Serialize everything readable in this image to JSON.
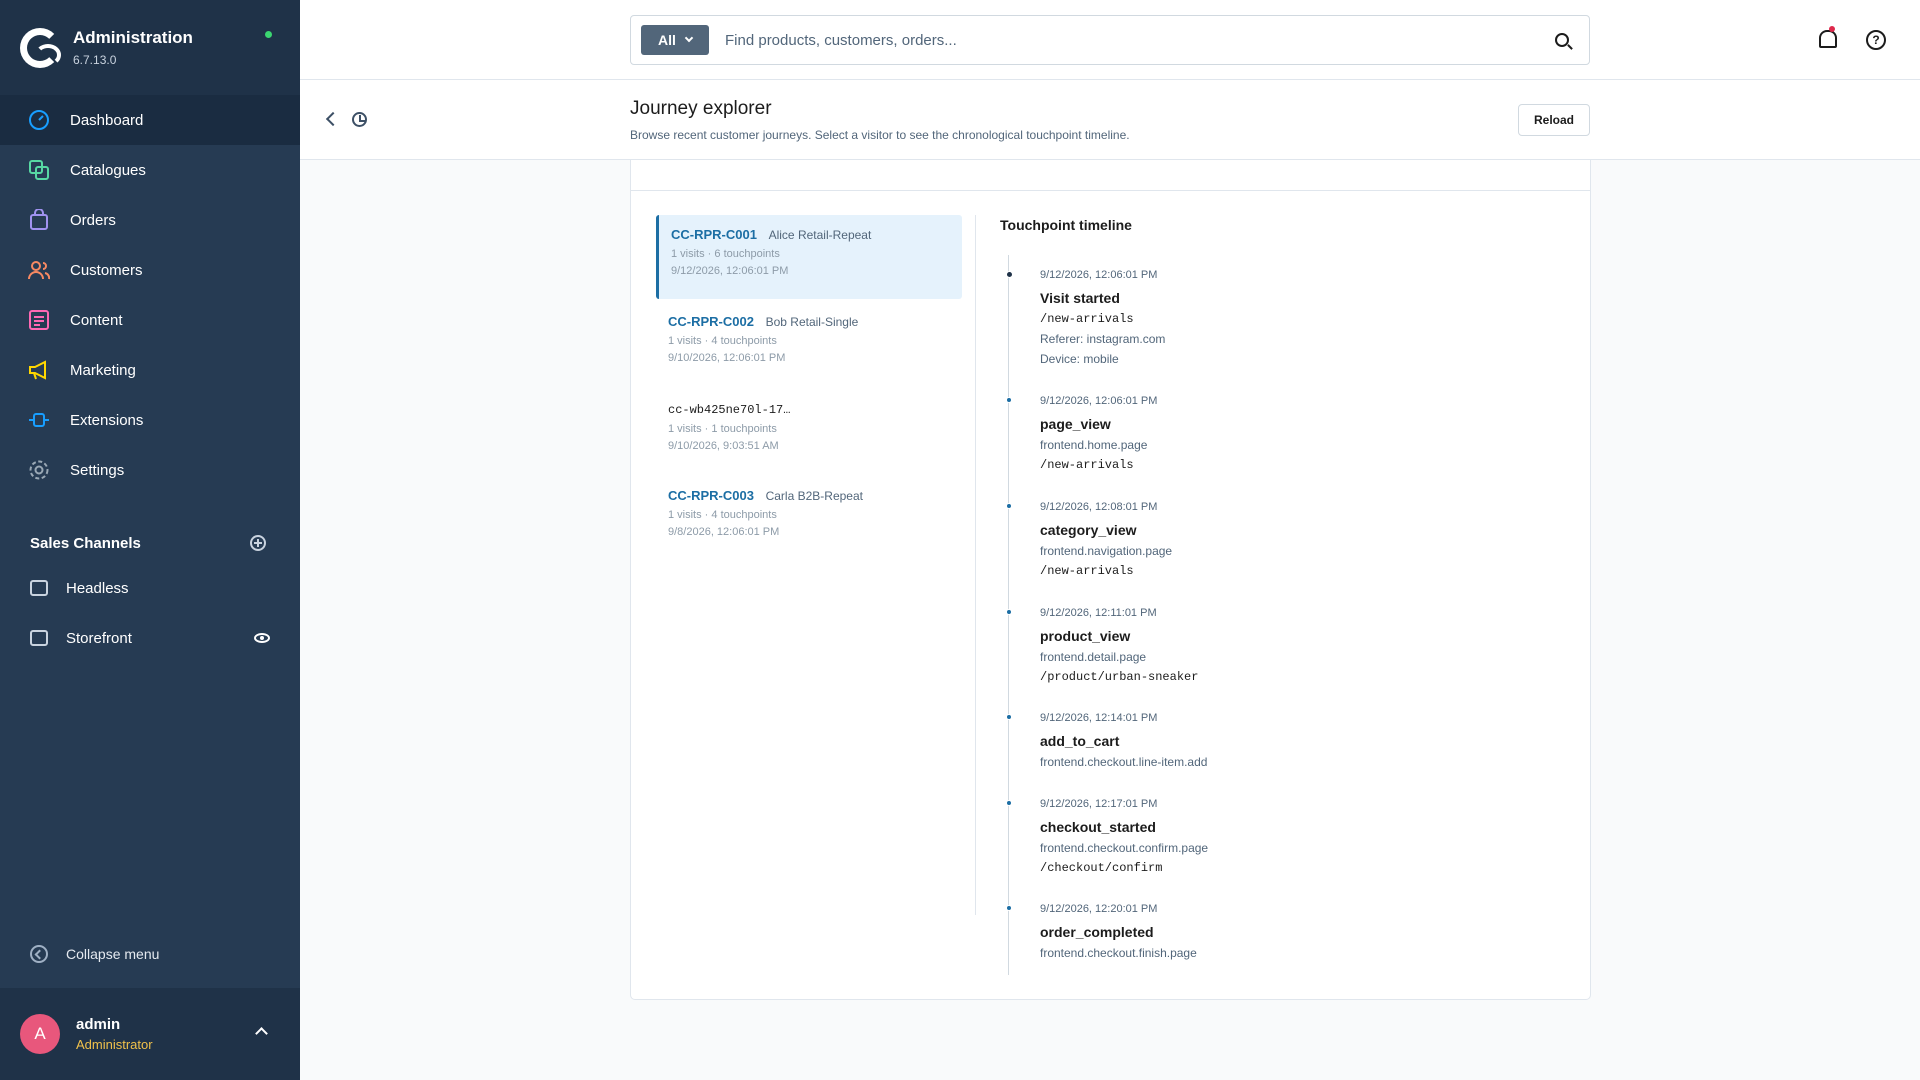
{
  "app": {
    "title": "Administration",
    "version": "6.7.13.0",
    "status_color": "#3bd671"
  },
  "nav": [
    {
      "label": "Dashboard",
      "icon": "dashboard-icon",
      "color": "#189eff",
      "active": true
    },
    {
      "label": "Catalogues",
      "icon": "catalogue-icon",
      "color": "#57d9a3"
    },
    {
      "label": "Orders",
      "icon": "orders-icon",
      "color": "#a092f0"
    },
    {
      "label": "Customers",
      "icon": "customers-icon",
      "color": "#f88962"
    },
    {
      "label": "Content",
      "icon": "content-icon",
      "color": "#ff68b4"
    },
    {
      "label": "Marketing",
      "icon": "marketing-icon",
      "color": "#ffd700"
    },
    {
      "label": "Extensions",
      "icon": "extensions-icon",
      "color": "#189eff"
    },
    {
      "label": "Settings",
      "icon": "settings-icon",
      "color": "#9aa8b5"
    }
  ],
  "sales_channels": {
    "title": "Sales Channels",
    "items": [
      {
        "label": "Headless",
        "icon": "basket-icon"
      },
      {
        "label": "Storefront",
        "icon": "storefront-icon"
      }
    ]
  },
  "collapse_label": "Collapse menu",
  "user": {
    "initial": "A",
    "name": "admin",
    "role": "Administrator"
  },
  "search": {
    "scope": "All",
    "placeholder": "Find products, customers, orders..."
  },
  "help_glyph": "?",
  "page": {
    "title": "Journey explorer",
    "description": "Browse recent customer journeys. Select a visitor to see the chronological touchpoint timeline.",
    "reload_label": "Reload"
  },
  "visitors": [
    {
      "id": "CC-RPR-C001",
      "name": "Alice Retail-Repeat",
      "stats": "1 visits · 6 touchpoints",
      "date": "9/12/2026, 12:06:01 PM",
      "active": true
    },
    {
      "id": "CC-RPR-C002",
      "name": "Bob Retail-Single",
      "stats": "1 visits · 4 touchpoints",
      "date": "9/10/2026, 12:06:01 PM"
    },
    {
      "id": "cc-wb425ne70l-17…",
      "name": "",
      "stats": "1 visits · 1 touchpoints",
      "date": "9/10/2026, 9:03:51 AM",
      "mono": true
    },
    {
      "id": "CC-RPR-C003",
      "name": "Carla B2B-Repeat",
      "stats": "1 visits · 4 touchpoints",
      "date": "9/8/2026, 12:06:01 PM"
    }
  ],
  "timeline": {
    "title": "Touchpoint timeline",
    "items": [
      {
        "time": "9/12/2026, 12:06:01 PM",
        "name": "Visit started",
        "path": "/new-arrivals",
        "referer": "Referer: instagram.com",
        "device": "Device: mobile"
      },
      {
        "time": "9/12/2026, 12:06:01 PM",
        "name": "page_view",
        "route": "frontend.home.page",
        "path": "/new-arrivals"
      },
      {
        "time": "9/12/2026, 12:08:01 PM",
        "name": "category_view",
        "route": "frontend.navigation.page",
        "path": "/new-arrivals"
      },
      {
        "time": "9/12/2026, 12:11:01 PM",
        "name": "product_view",
        "route": "frontend.detail.page",
        "path": "/product/urban-sneaker"
      },
      {
        "time": "9/12/2026, 12:14:01 PM",
        "name": "add_to_cart",
        "route": "frontend.checkout.line-item.add"
      },
      {
        "time": "9/12/2026, 12:17:01 PM",
        "name": "checkout_started",
        "route": "frontend.checkout.confirm.page",
        "path": "/checkout/confirm"
      },
      {
        "time": "9/12/2026, 12:20:01 PM",
        "name": "order_completed",
        "route": "frontend.checkout.finish.page"
      }
    ]
  }
}
